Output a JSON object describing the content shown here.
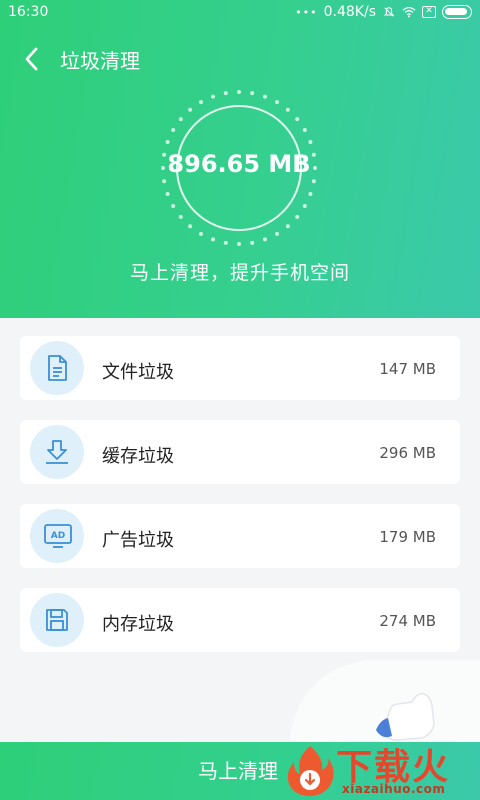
{
  "status_bar": {
    "time": "16:30",
    "dots": "•••",
    "speed": "0.48K/s",
    "icons": [
      "mute-icon",
      "wifi-icon",
      "sim-x-icon",
      "battery-icon"
    ]
  },
  "header": {
    "back_icon": "chevron-left-icon",
    "title": "垃圾清理",
    "total_size": "896.65 MB",
    "subtitle": "马上清理，提升手机空间"
  },
  "items": [
    {
      "icon": "file-icon",
      "label": "文件垃圾",
      "size": "147 MB"
    },
    {
      "icon": "download-cache-icon",
      "label": "缓存垃圾",
      "size": "296 MB"
    },
    {
      "icon": "ad-monitor-icon",
      "label": "广告垃圾",
      "size": "179 MB"
    },
    {
      "icon": "memory-card-icon",
      "label": "内存垃圾",
      "size": "274 MB"
    }
  ],
  "bottom_button": {
    "label": "马上清理"
  },
  "watermark": {
    "text": "下载火",
    "domain": "xiazaihuo.com"
  },
  "colors": {
    "header_start": "#2ecf79",
    "header_end": "#3bc9ab",
    "icon_bg": "#dff0fb",
    "icon_stroke": "#3a8fd6",
    "watermark_red": "#e6462b"
  }
}
